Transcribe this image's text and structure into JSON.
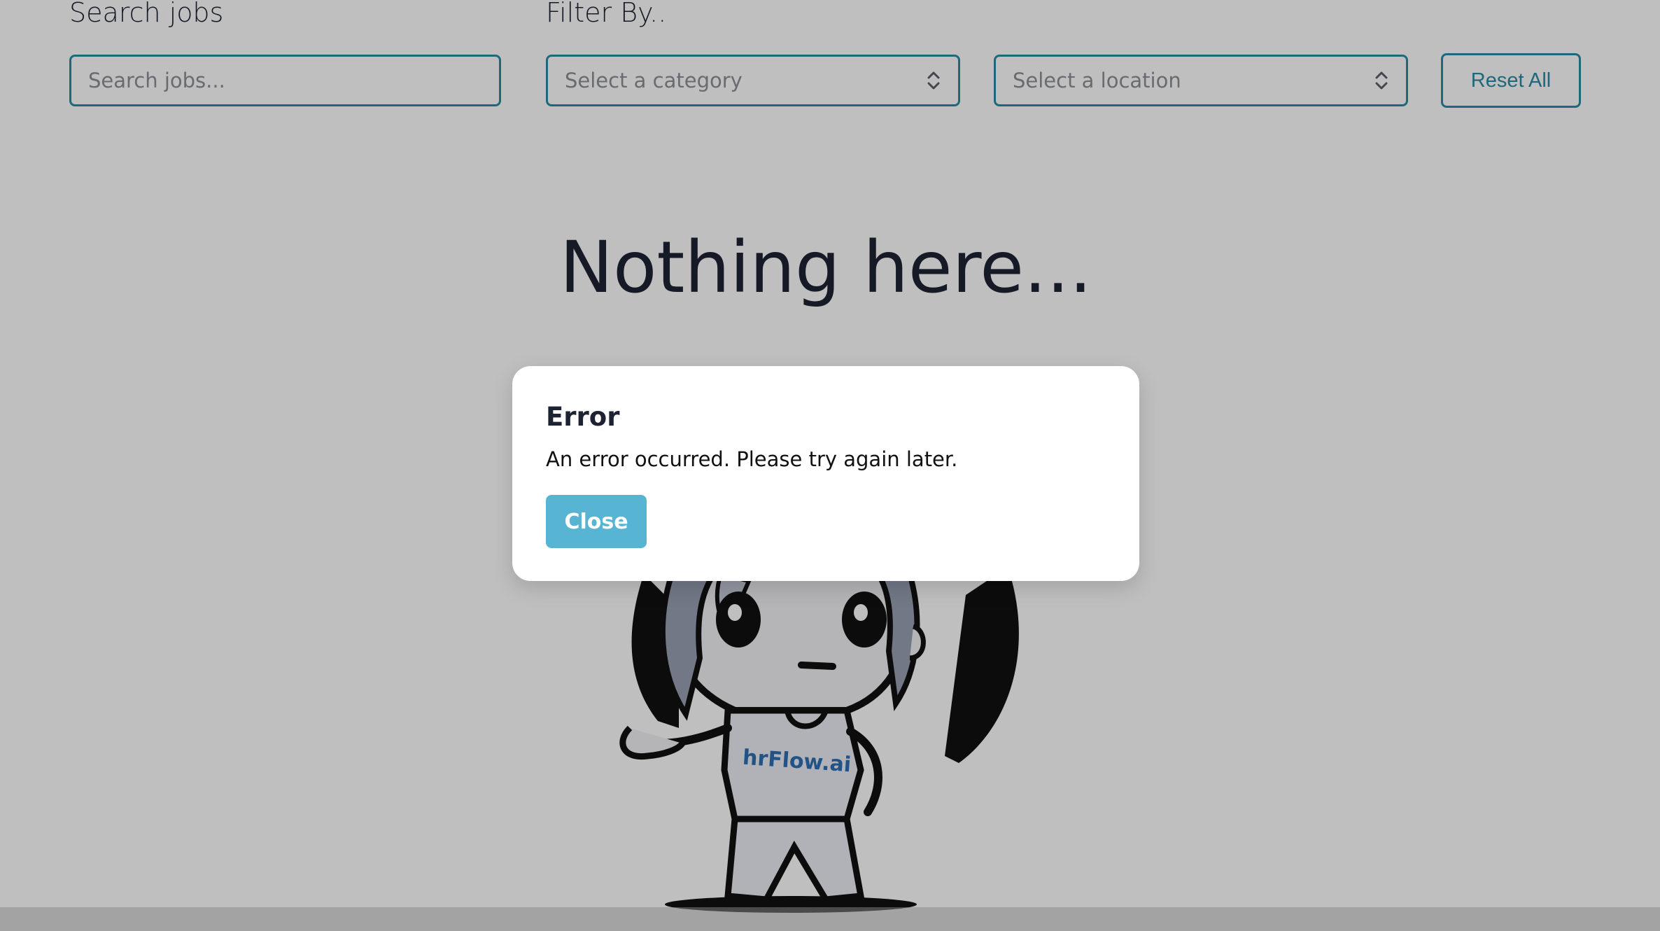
{
  "search": {
    "label": "Search jobs",
    "placeholder": "Search jobs..."
  },
  "filters": {
    "label": "Filter By..",
    "category_placeholder": "Select a category",
    "location_placeholder": "Select a location",
    "reset_label": "Reset All"
  },
  "empty_state": {
    "title": "Nothing here...",
    "mascot_shirt_text": "hrFlow.ai"
  },
  "modal": {
    "title": "Error",
    "message": "An error occurred. Please try again later.",
    "close_label": "Close"
  },
  "colors": {
    "accent": "#2a8aa5",
    "button": "#58b4d3",
    "text": "#1e2333"
  }
}
